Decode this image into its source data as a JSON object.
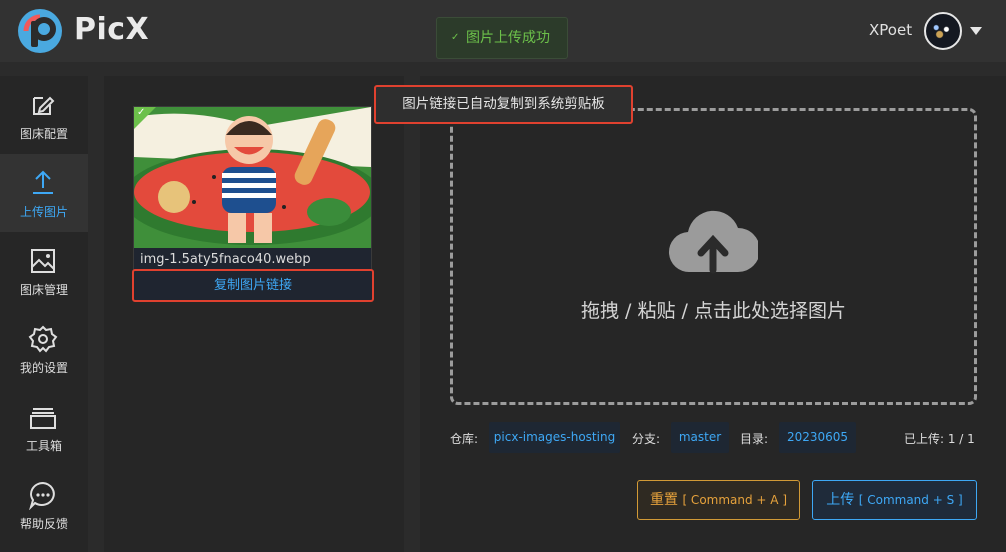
{
  "app": {
    "brand": "PicX"
  },
  "toast": {
    "message": "图片上传成功"
  },
  "user": {
    "name": "XPoet"
  },
  "sidebar": {
    "items": [
      {
        "label": "图床配置",
        "icon": "edit-icon"
      },
      {
        "label": "上传图片",
        "icon": "upload-icon",
        "active": true
      },
      {
        "label": "图床管理",
        "icon": "image-icon"
      },
      {
        "label": "我的设置",
        "icon": "gear-icon"
      },
      {
        "label": "工具箱",
        "icon": "toolbox-icon"
      },
      {
        "label": "帮助反馈",
        "icon": "chat-icon"
      }
    ]
  },
  "uploaded_card": {
    "filename": "img-1.5aty5fnaco40.webp",
    "copy_label": "复制图片链接"
  },
  "tooltip": {
    "text": "图片链接已自动复制到系统剪贴板"
  },
  "drop_zone": {
    "text": "拖拽 / 粘贴 / 点击此处选择图片"
  },
  "info": {
    "repo_label": "仓库:",
    "repo_value": "picx-images-hosting",
    "branch_label": "分支:",
    "branch_value": "master",
    "dir_label": "目录:",
    "dir_value": "20230605",
    "uploaded": "已上传: 1 / 1"
  },
  "actions": {
    "reset_label": "重置",
    "reset_shortcut": "[ Command + A ]",
    "upload_label": "上传",
    "upload_shortcut": "[ Command + S ]"
  },
  "colors": {
    "accent": "#3ea8f5",
    "success": "#6cc04a",
    "warning": "#e6a23c",
    "highlight": "#e0412f"
  }
}
